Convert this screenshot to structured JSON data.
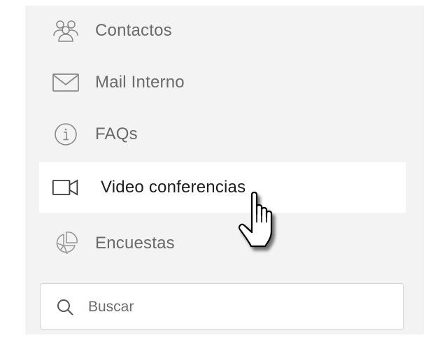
{
  "menu": {
    "items": [
      {
        "label": "Contactos",
        "icon": "contacts-group-icon"
      },
      {
        "label": "Mail Interno",
        "icon": "envelope-icon"
      },
      {
        "label": "FAQs",
        "icon": "info-circle-icon"
      },
      {
        "label": "Video conferencias",
        "icon": "video-camera-icon",
        "active": true
      },
      {
        "label": "Encuestas",
        "icon": "pie-chart-icon"
      }
    ]
  },
  "search": {
    "placeholder": "Buscar",
    "value": ""
  },
  "colors": {
    "sidebar_bg": "#f3f3f3",
    "active_bg": "#ffffff",
    "icon_gray": "#7a7a7a",
    "label_gray": "#6a6a6a",
    "label_active": "#1d1d1d"
  }
}
